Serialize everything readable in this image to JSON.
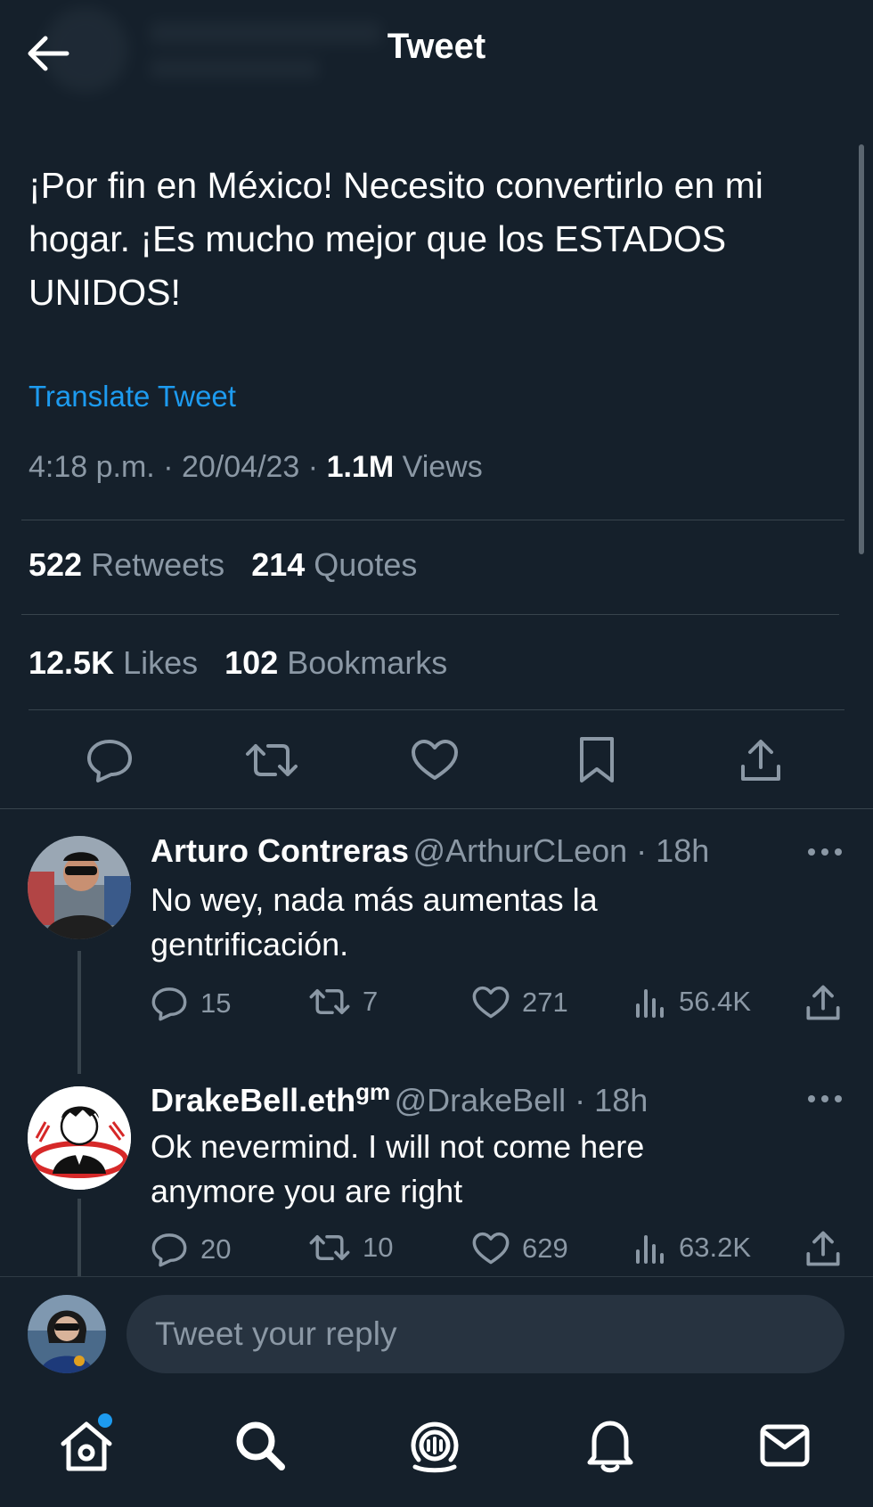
{
  "header": {
    "title": "Tweet"
  },
  "tweet": {
    "text_line1": "¡Por fin en México!  Necesito convertirlo en mi",
    "text_line2": "hogar.  ¡Es mucho mejor que los ESTADOS",
    "text_line3": "UNIDOS!",
    "translate_label": "Translate Tweet",
    "time": "4:18 p.m.",
    "date": "20/04/23",
    "views_count": "1.1M",
    "views_label": "Views",
    "retweets_count": "522",
    "retweets_label": "Retweets",
    "quotes_count": "214",
    "quotes_label": "Quotes",
    "likes_count": "12.5K",
    "likes_label": "Likes",
    "bookmarks_count": "102",
    "bookmarks_label": "Bookmarks"
  },
  "replies": [
    {
      "name": "Arturo Contreras",
      "handle": "@ArthurCLeon",
      "age": "18h",
      "text_line1": "No wey, nada más aumentas la",
      "text_line2": "gentrificación.",
      "replies": "15",
      "retweets": "7",
      "likes": "271",
      "views": "56.4K"
    },
    {
      "name": "DrakeBell.eth",
      "name_sup": "gm",
      "handle": "@DrakeBell",
      "age": "18h",
      "text_line1": "Ok nevermind. I will not come here",
      "text_line2": "anymore you are right",
      "replies": "20",
      "retweets": "10",
      "likes": "629",
      "views": "63.2K"
    }
  ],
  "compose": {
    "placeholder": "Tweet your reply"
  },
  "icons": {
    "back": "arrow-left-icon",
    "reply": "reply-icon",
    "retweet": "retweet-icon",
    "like": "heart-icon",
    "bookmark": "bookmark-icon",
    "share": "share-icon",
    "views": "views-icon",
    "more": "more-icon",
    "home": "home-icon",
    "search": "search-icon",
    "spaces": "spaces-icon",
    "notifications": "bell-icon",
    "messages": "mail-icon"
  },
  "colors": {
    "background": "#15202b",
    "accent": "#1d9bf0",
    "muted": "#8b98a5",
    "divider": "#38444d"
  }
}
